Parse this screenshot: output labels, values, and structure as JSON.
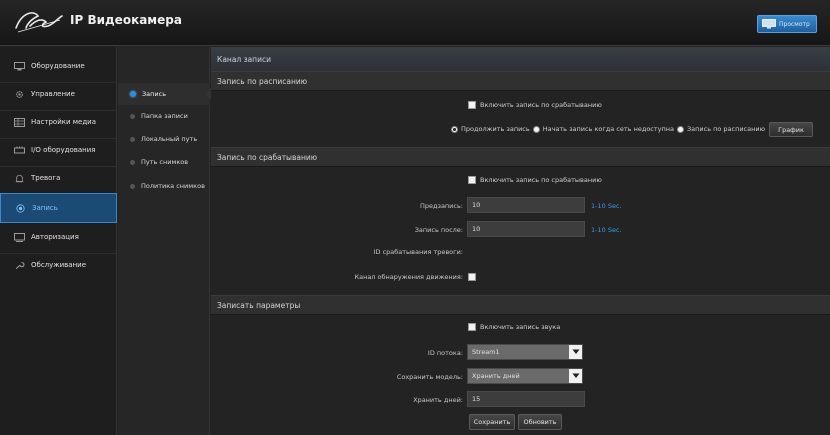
{
  "header": {
    "brand": "IP Видеокамера",
    "preview_label": "Просмотр"
  },
  "sidebar": {
    "items": [
      {
        "label": "Оборудование",
        "icon": "monitor-icon"
      },
      {
        "label": "Управление",
        "icon": "gear-icon"
      },
      {
        "label": "Настройки медиа",
        "icon": "media-icon"
      },
      {
        "label": "I/O оборудования",
        "icon": "io-icon"
      },
      {
        "label": "Тревога",
        "icon": "alarm-icon"
      },
      {
        "label": "Запись",
        "icon": "record-icon"
      },
      {
        "label": "Авторизация",
        "icon": "login-icon"
      },
      {
        "label": "Обслуживание",
        "icon": "wrench-icon"
      }
    ],
    "active_index": 5
  },
  "submenu": {
    "items": [
      "Запись",
      "Папка записи",
      "Локальный путь",
      "Путь снимков",
      "Политика снимков"
    ],
    "active_index": 0
  },
  "panel_title": "Канал записи",
  "schedule": {
    "title": "Запись по расписанию",
    "checkbox_label": "Включить запись по срабатыванию",
    "radio_options": [
      "Продолжить запись",
      "Начать запись когда сеть недоступна",
      "Запись по расписанию"
    ],
    "selected_radio": 0,
    "graph_button": "График"
  },
  "trigger": {
    "title": "Запись по срабатыванию",
    "checkbox_label": "Включить запись по срабатыванию",
    "pre_label": "Предзапись:",
    "pre_value": "10",
    "pre_hint": "1-10 Sec.",
    "post_label": "Запись после:",
    "post_value": "10",
    "post_hint": "1-10 Sec.",
    "alarm_id_label": "ID срабатывания тревоги:",
    "motion_label": "Канал обнаружения движения:"
  },
  "params": {
    "title": "Записать параметры",
    "audio_label": "Включить запись звука",
    "stream_label": "ID потока:",
    "stream_value": "Stream1",
    "model_label": "Сохранить модель:",
    "model_value": "Хранить дней",
    "days_label": "Хранить дней:",
    "days_value": "15"
  },
  "actions": {
    "save": "Сохранить",
    "refresh": "Обновить"
  },
  "colors": {
    "accent": "#3b9be6",
    "active_bg": "#1b4a75"
  }
}
